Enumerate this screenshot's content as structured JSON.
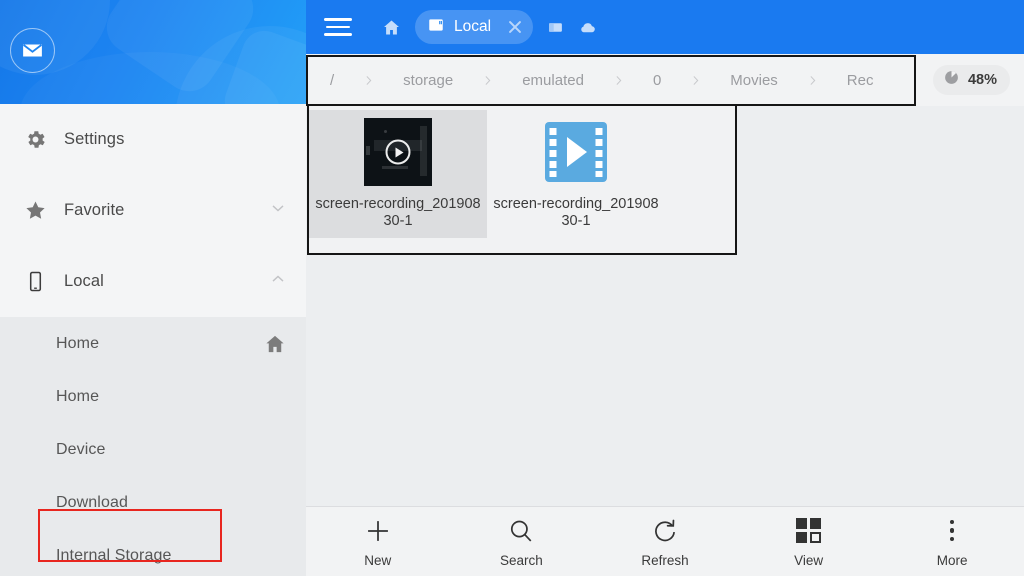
{
  "sidebar": {
    "avatar_icon": "envelope-icon",
    "nav": [
      {
        "label": "Settings",
        "icon": "gear-icon",
        "chevron": "none"
      },
      {
        "label": "Favorite",
        "icon": "star-icon",
        "chevron": "chevron-down-icon"
      },
      {
        "label": "Local",
        "icon": "phone-icon",
        "chevron": "chevron-up-icon"
      }
    ],
    "sub_items": [
      {
        "label": "Home",
        "trailing_icon": "home-icon"
      },
      {
        "label": "Home",
        "trailing_icon": "none"
      },
      {
        "label": "Device",
        "trailing_icon": "none"
      },
      {
        "label": "Download",
        "trailing_icon": "none"
      },
      {
        "label": "Internal Storage",
        "trailing_icon": "none"
      }
    ]
  },
  "topbar": {
    "menu_icon": "hamburger-icon",
    "home_icon": "home-icon",
    "tab": {
      "label": "Local",
      "icon": "storage-card-icon",
      "close_icon": "close-icon"
    },
    "window_icon": "window-icon",
    "cloud_icon": "cloud-icon"
  },
  "breadcrumb": {
    "segments": [
      "/",
      "storage",
      "emulated",
      "0",
      "Movies",
      "Rec"
    ],
    "separator_icon": "chevron-right-icon"
  },
  "storage_badge": {
    "icon": "pie-chart-icon",
    "percent": "48%"
  },
  "files": [
    {
      "name": "screen-recording_20190830-1",
      "thumb": "video-thumbnail",
      "selected": true
    },
    {
      "name": "screen-recording_20190830-1",
      "thumb": "film-play-icon",
      "selected": false
    }
  ],
  "bottombar": [
    {
      "label": "New",
      "icon": "plus-icon"
    },
    {
      "label": "Search",
      "icon": "search-icon"
    },
    {
      "label": "Refresh",
      "icon": "refresh-icon"
    },
    {
      "label": "View",
      "icon": "grid-view-icon"
    },
    {
      "label": "More",
      "icon": "more-dots-icon"
    }
  ],
  "colors": {
    "brand_blue": "#1a7af0",
    "annotation_red": "#e8261f",
    "annotation_black": "#151515",
    "file_icon_blue": "#5aaae0"
  }
}
